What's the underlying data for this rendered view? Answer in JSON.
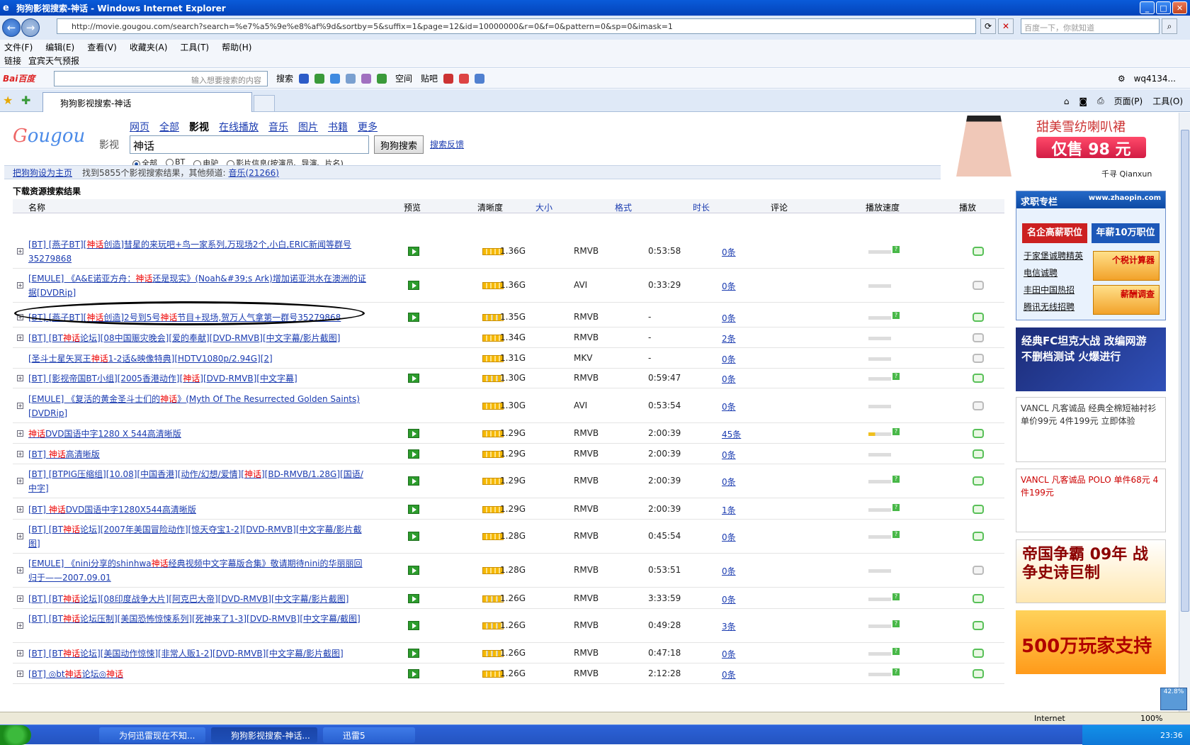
{
  "window": {
    "title": "狗狗影视搜索-神话 - Windows Internet Explorer"
  },
  "address": {
    "url": "http://movie.gougou.com/search?search=%e7%a5%9e%e8%af%9d&sortby=5&suffix=1&page=12&id=10000000&r=0&f=0&pattern=0&sp=0&imask=1",
    "search_placeholder": "百度一下，你就知道"
  },
  "menu": [
    "文件(F)",
    "编辑(E)",
    "查看(V)",
    "收藏夹(A)",
    "工具(T)",
    "帮助(H)"
  ],
  "links": {
    "label": "链接",
    "item": "宜宾天气预报"
  },
  "baidu": {
    "logo": "Bai百度",
    "placeholder": "输入想要搜索的内容",
    "search": "搜索",
    "space": "空间",
    "tieba": "贴吧",
    "user": "wq4134..."
  },
  "tab": {
    "title": "狗狗影视搜索-神话",
    "page": "页面(P)",
    "tools": "工具(O)"
  },
  "site": {
    "logo": "Gougou",
    "logo_sub": "影视",
    "channels": [
      "网页",
      "全部",
      "影视",
      "在线播放",
      "音乐",
      "图片",
      "书籍",
      "更多"
    ],
    "current_channel": "影视",
    "query": "神话",
    "search_button": "狗狗搜索",
    "feedback": "搜索反馈",
    "filters": [
      "全部",
      "BT",
      "电驴",
      "影片信息(按演员、导演、片名)"
    ],
    "set_home": "把狗狗设为主页",
    "result_info": "找到5855个影视搜索结果，其他频道:",
    "music_link": "音乐(21266)",
    "section_title": "下载资源搜索结果"
  },
  "ad_top": {
    "title": "甜美雪纺喇叭裙",
    "price": "仅售 98 元",
    "brand": "千寻 Qianxun"
  },
  "table": {
    "headers": [
      "名称",
      "预览",
      "清晰度",
      "大小",
      "格式",
      "时长",
      "评论",
      "播放速度",
      "播放"
    ],
    "rows": [
      {
        "name": "[BT] [燕子BT][神话创造]彗星的来玩吧+鸟一家系列,万现场2个,小白,ERIC新闻等群号35279868",
        "size": "1.36G",
        "format": "RMVB",
        "duration": "0:53:58",
        "comments": "0条"
      },
      {
        "name": "[EMULE] 《A&E诺亚方舟：神话还是现实》(Noah&#39;s Ark)增加诺亚洪水在澳洲的证据[DVDRip]",
        "size": "1.36G",
        "format": "AVI",
        "duration": "0:33:29",
        "comments": "0条"
      },
      {
        "name": "[BT] [燕子BT][神话创造]2号到5号神话节目+现场,贺万人气拿第一群号35279868",
        "size": "1.35G",
        "format": "RMVB",
        "duration": "-",
        "comments": "0条"
      },
      {
        "name": "[BT] [BT神话论坛][08中国赈灾晚会][爱的奉献][DVD-RMVB][中文字幕/影片截图]",
        "size": "1.34G",
        "format": "RMVB",
        "duration": "-",
        "comments": "2条"
      },
      {
        "name": "[圣斗士星矢冥王神话1-2话&映像特典][HDTV1080p/2.94G][2]",
        "size": "1.31G",
        "format": "MKV",
        "duration": "-",
        "comments": "0条"
      },
      {
        "name": "[BT] [影视帝国BT小组][2005香港动作][神话][DVD-RMVB][中文字幕]",
        "size": "1.30G",
        "format": "RMVB",
        "duration": "0:59:47",
        "comments": "0条"
      },
      {
        "name": "[EMULE] 《复活的黄金圣斗士们的神话》(Myth Of The Resurrected Golden Saints)[DVDRip]",
        "size": "1.30G",
        "format": "AVI",
        "duration": "0:53:54",
        "comments": "0条"
      },
      {
        "name": "神话DVD国语中字1280 X 544高清晰版",
        "size": "1.29G",
        "format": "RMVB",
        "duration": "2:00:39",
        "comments": "45条"
      },
      {
        "name": "[BT] 神话高清晰版",
        "size": "1.29G",
        "format": "RMVB",
        "duration": "2:00:39",
        "comments": "0条"
      },
      {
        "name": "[BT] [BTPIG压缩组][10.08][中国香港][动作/幻想/爱情][神话][BD-RMVB/1.28G][国语/中字]",
        "size": "1.29G",
        "format": "RMVB",
        "duration": "2:00:39",
        "comments": "0条"
      },
      {
        "name": "[BT] 神话DVD国语中字1280X544高清晰版",
        "size": "1.29G",
        "format": "RMVB",
        "duration": "2:00:39",
        "comments": "1条"
      },
      {
        "name": "[BT] [BT神话论坛][2007年美国冒险动作][惊天夺宝1-2][DVD-RMVB][中文字幕/影片截图]",
        "size": "1.28G",
        "format": "RMVB",
        "duration": "0:45:54",
        "comments": "0条"
      },
      {
        "name": "[EMULE] 《nini分享的shinhwa神话经典视频中文字幕版合集》敬请期待nini的华丽丽回归于——2007.09.01",
        "size": "1.28G",
        "format": "RMVB",
        "duration": "0:53:51",
        "comments": "0条"
      },
      {
        "name": "[BT] [BT神话论坛][08印度战争大片][阿克巴大帝][DVD-RMVB][中文字幕/影片截图]",
        "size": "1.26G",
        "format": "RMVB",
        "duration": "3:33:59",
        "comments": "0条"
      },
      {
        "name": "[BT] [BT神话论坛压制][美国恐怖惊悚系列][死神来了1-3][DVD-RMVB][中文字幕/截图]",
        "size": "1.26G",
        "format": "RMVB",
        "duration": "0:49:28",
        "comments": "3条"
      },
      {
        "name": "[BT] [BT神话论坛][美国动作惊悚][非常人贩1-2][DVD-RMVB][中文字幕/影片截图]",
        "size": "1.26G",
        "format": "RMVB",
        "duration": "0:47:18",
        "comments": "0条"
      },
      {
        "name": "[BT] ◎bt神话论坛◎神话",
        "size": "1.26G",
        "format": "RMVB",
        "duration": "2:12:28",
        "comments": "0条"
      }
    ]
  },
  "zhaopin": {
    "title": "求职专栏",
    "site": "www.zhaopin.com",
    "btn1": "名企高薪职位",
    "btn2": "年薪10万职位",
    "links": [
      "于家堡诚聘精英",
      "电信诚聘",
      "丰田中国热招",
      "腾讯无线招聘"
    ],
    "tile1": "个税计算器",
    "tile2": "薪酬调查"
  },
  "banners": {
    "battle": "经典FC坦克大战 改编网游 不删档测试 火爆进行",
    "vancl1": "VANCL 凡客诚品 经典全棉短袖衬衫 单价99元 4件199元 立即体验",
    "vancl2": "VANCL 凡客诚品 POLO 单件68元 4件199元",
    "dg": "帝国争霸 09年 战争史诗巨制",
    "wan": "500万玩家支持"
  },
  "status": {
    "zone": "Internet",
    "zoom": "100%",
    "side": "42.8%"
  },
  "taskbar": {
    "t1": "为何迅雷现在不知...",
    "t2": "狗狗影视搜索-神话...",
    "t3": "迅雷5",
    "clock": "23:36"
  }
}
